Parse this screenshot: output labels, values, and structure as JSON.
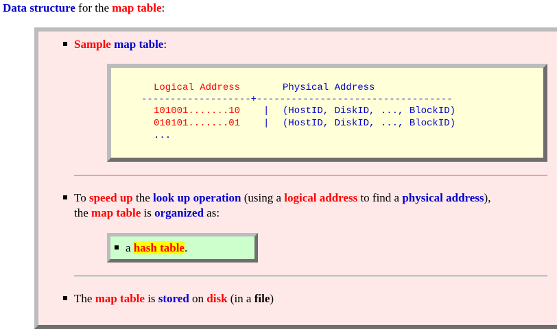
{
  "heading": {
    "part1": "Data structure",
    "part2": " for the ",
    "part3": "map table",
    "part4": ":"
  },
  "bullet1": {
    "w1": "Sample",
    "w2": "map table",
    "w3": ":"
  },
  "table": {
    "header_left": "Logical Address",
    "header_right": "Physical Address",
    "separator": "-------------------+----------------------------------",
    "rows": [
      {
        "logical": "101001.......10",
        "sep": "|",
        "physical": "(HostID, DiskID, ..., BlockID)"
      },
      {
        "logical": "010101.......01",
        "sep": "|",
        "physical": "(HostID, DiskID, ..., BlockID)"
      }
    ],
    "ellipsis": "..."
  },
  "bullet2": {
    "t1": "To ",
    "t2": "speed up",
    "t3": " the ",
    "t4": "look up operation",
    "t5": " (using a ",
    "t6": "logical address",
    "t7": " to find a ",
    "t8": "physical address",
    "t9": "),",
    "l2a": "the ",
    "l2b": "map table",
    "l2c": " is ",
    "l2d": "organized",
    "l2e": " as:"
  },
  "hash": {
    "pre": "a ",
    "term": "hash table",
    "post": "."
  },
  "bullet3": {
    "t1": "The ",
    "t2": "map table",
    "t3": " is ",
    "t4": "stored",
    "t5": " on ",
    "t6": "disk",
    "t7": " (in a ",
    "t8": "file",
    "t9": ")"
  },
  "colors": {
    "red": "#ff0000",
    "blue": "#0000cc",
    "panel_bg": "#ffe8e8",
    "code_bg": "#ffffd8",
    "hash_bg": "#ccffcc",
    "highlight": "#ffff00"
  },
  "icons": [
    "bullet-square-icon"
  ]
}
